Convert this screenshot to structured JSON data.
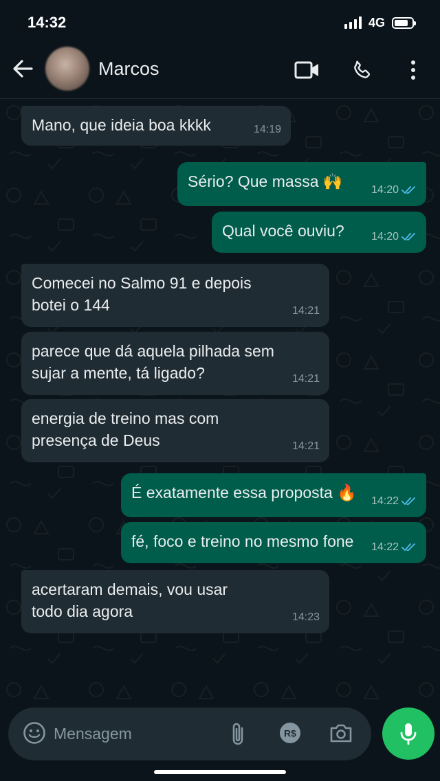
{
  "status_bar": {
    "time": "14:32",
    "network": "4G",
    "battery_level": 0.8
  },
  "header": {
    "contact_name": "Marcos",
    "icons": [
      "back-arrow-icon",
      "avatar",
      "video-call-icon",
      "phone-call-icon",
      "more-options-icon"
    ]
  },
  "messages": [
    {
      "direction": "in",
      "text": "Mano, que ideia boa kkkk",
      "time": "14:19"
    },
    {
      "direction": "out",
      "text": "Sério? Que massa 🙌",
      "time": "14:20",
      "status": "read"
    },
    {
      "direction": "out",
      "text": "Qual você ouviu?",
      "time": "14:20",
      "status": "read"
    },
    {
      "direction": "in",
      "text": "Comecei no Salmo 91 e depois\nbotei o 144",
      "time": "14:21"
    },
    {
      "direction": "in",
      "text": "parece que dá aquela pilhada sem\nsujar a mente, tá ligado?",
      "time": "14:21"
    },
    {
      "direction": "in",
      "text": "energia de treino mas com\npresença de Deus",
      "time": "14:21"
    },
    {
      "direction": "out",
      "text": "É exatamente essa proposta 🔥",
      "time": "14:22",
      "status": "read"
    },
    {
      "direction": "out",
      "text": "fé, foco e treino no mesmo fone",
      "time": "14:22",
      "status": "read"
    },
    {
      "direction": "in",
      "text": "acertaram demais, vou usar\ntodo dia agora",
      "time": "14:23"
    }
  ],
  "composer": {
    "placeholder": "Mensagem",
    "value": "",
    "payment_label": "R$",
    "icons": [
      "emoji-icon",
      "attach-icon",
      "payment-icon",
      "camera-icon",
      "mic-icon"
    ]
  },
  "colors": {
    "background": "#0b141a",
    "incoming_bubble": "#202c33",
    "outgoing_bubble": "#005c4b",
    "read_ticks": "#53bdeb",
    "mic_button": "#21c063"
  }
}
